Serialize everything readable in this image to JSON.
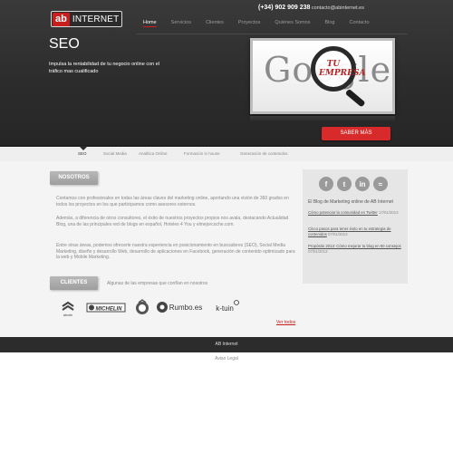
{
  "header": {
    "logo_ab": "ab",
    "logo_text": "INTERNET",
    "phone": "(+34) 902 909 238",
    "email": "contacto@abinternet.es",
    "nav": [
      "Home",
      "Servicios",
      "Clientes",
      "Proyectos",
      "Quiénes Somos",
      "Blog",
      "Contacto"
    ],
    "active_nav": "Home"
  },
  "hero": {
    "title": "SEO",
    "text": "Impulsa la rentabilidad de tu negocio online con el tráfico mas cualificado",
    "billboard_word": "Google",
    "lens_text": "TU EMPRESA",
    "cta": "SABER MÁS"
  },
  "subnav": {
    "items": [
      "SEO",
      "Social Media",
      "Analítica Online",
      "Formación in house",
      "Generación de contenidos"
    ],
    "active": "SEO"
  },
  "nosotros": {
    "tab": "NOSOTROS",
    "p1": "Contamos con profesionales en todas las áreas claves del marketing online, aportando una visión de 360 grados en todos los proyectos en los que participamos como asesores externos.",
    "p2": "Además, a diferencia de otros consultores, el éxito de nuestros proyectos propios nos avala, destacando Actualidad Blog, una de las principales red de blogs en español, Hoteles 4 You y elmejorcoche.com.",
    "p3": "Entre otras áreas, podemos ofrecerle nuestra experiencia en posicionamiento en buscadores (SEO), Social Media Marketing, diseño y desarrollo Web, desarrollo de aplicaciones en Facebook, generación de contenido optimizado para la web y Mobile Marketing."
  },
  "clientes": {
    "tab": "CLIENTES",
    "label": "Algunas de las empresas que confían en nosotros",
    "logos": [
      "citroën",
      "MICHELIN",
      "cerveza",
      "Rumbo.es",
      "k-tuin"
    ],
    "ver_todos": "Ver todos"
  },
  "sidebar": {
    "social_icons": [
      "facebook-icon",
      "twitter-icon",
      "linkedin-icon",
      "rss-icon"
    ],
    "title": "El Blog de Marketing online de AB Internet",
    "posts": [
      {
        "title": "Cómo potenciar la comunidad en Twitter",
        "date": "17/01/2013"
      },
      {
        "title": "Cinco pasos para tener éxito en tu estrategia de contenidos",
        "date": "07/01/2013"
      },
      {
        "title": "Propósito 2013: Cómo mejorar tu blog en 50 consejos",
        "date": "07/01/2013"
      }
    ]
  },
  "footer": {
    "brand": "AB Internet",
    "legal": "Aviso Legal"
  },
  "colors": {
    "accent": "#c81e1e",
    "header_bg": "#333333",
    "content_bg": "#f4f4f4"
  }
}
